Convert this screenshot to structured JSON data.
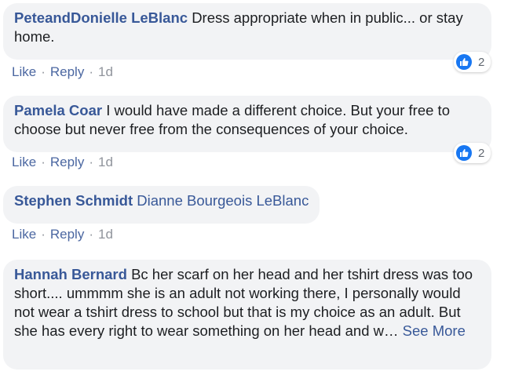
{
  "comments": [
    {
      "author": "PeteandDonielle LeBlanc",
      "text": "Dress appropriate when in public... or stay home.",
      "like": "Like",
      "reply": "Reply",
      "time": "1d",
      "reaction_count": "2"
    },
    {
      "author": "Pamela Coar",
      "text": "I would have made a different choice. But your free to choose but never free from the consequences of your choice.",
      "like": "Like",
      "reply": "Reply",
      "time": "1d",
      "reaction_count": "2"
    },
    {
      "author": "Stephen Schmidt",
      "tag": "Dianne Bourgeois LeBlanc",
      "like": "Like",
      "reply": "Reply",
      "time": "1d"
    },
    {
      "author": "Hannah Bernard",
      "text": "Bc her scarf on her head and her tshirt dress was too short.... ummmm she is an adult not working there, I personally would not wear a tshirt dress to school but that is my choice as an adult. But she has every right to wear something on her head and w…",
      "see_more": "See More"
    }
  ],
  "separator": "·",
  "colors": {
    "author": "#385898",
    "bubble": "#f2f3f5",
    "like_icon": "#1877f2"
  },
  "icons": {
    "reaction": "thumbs-up-icon"
  }
}
